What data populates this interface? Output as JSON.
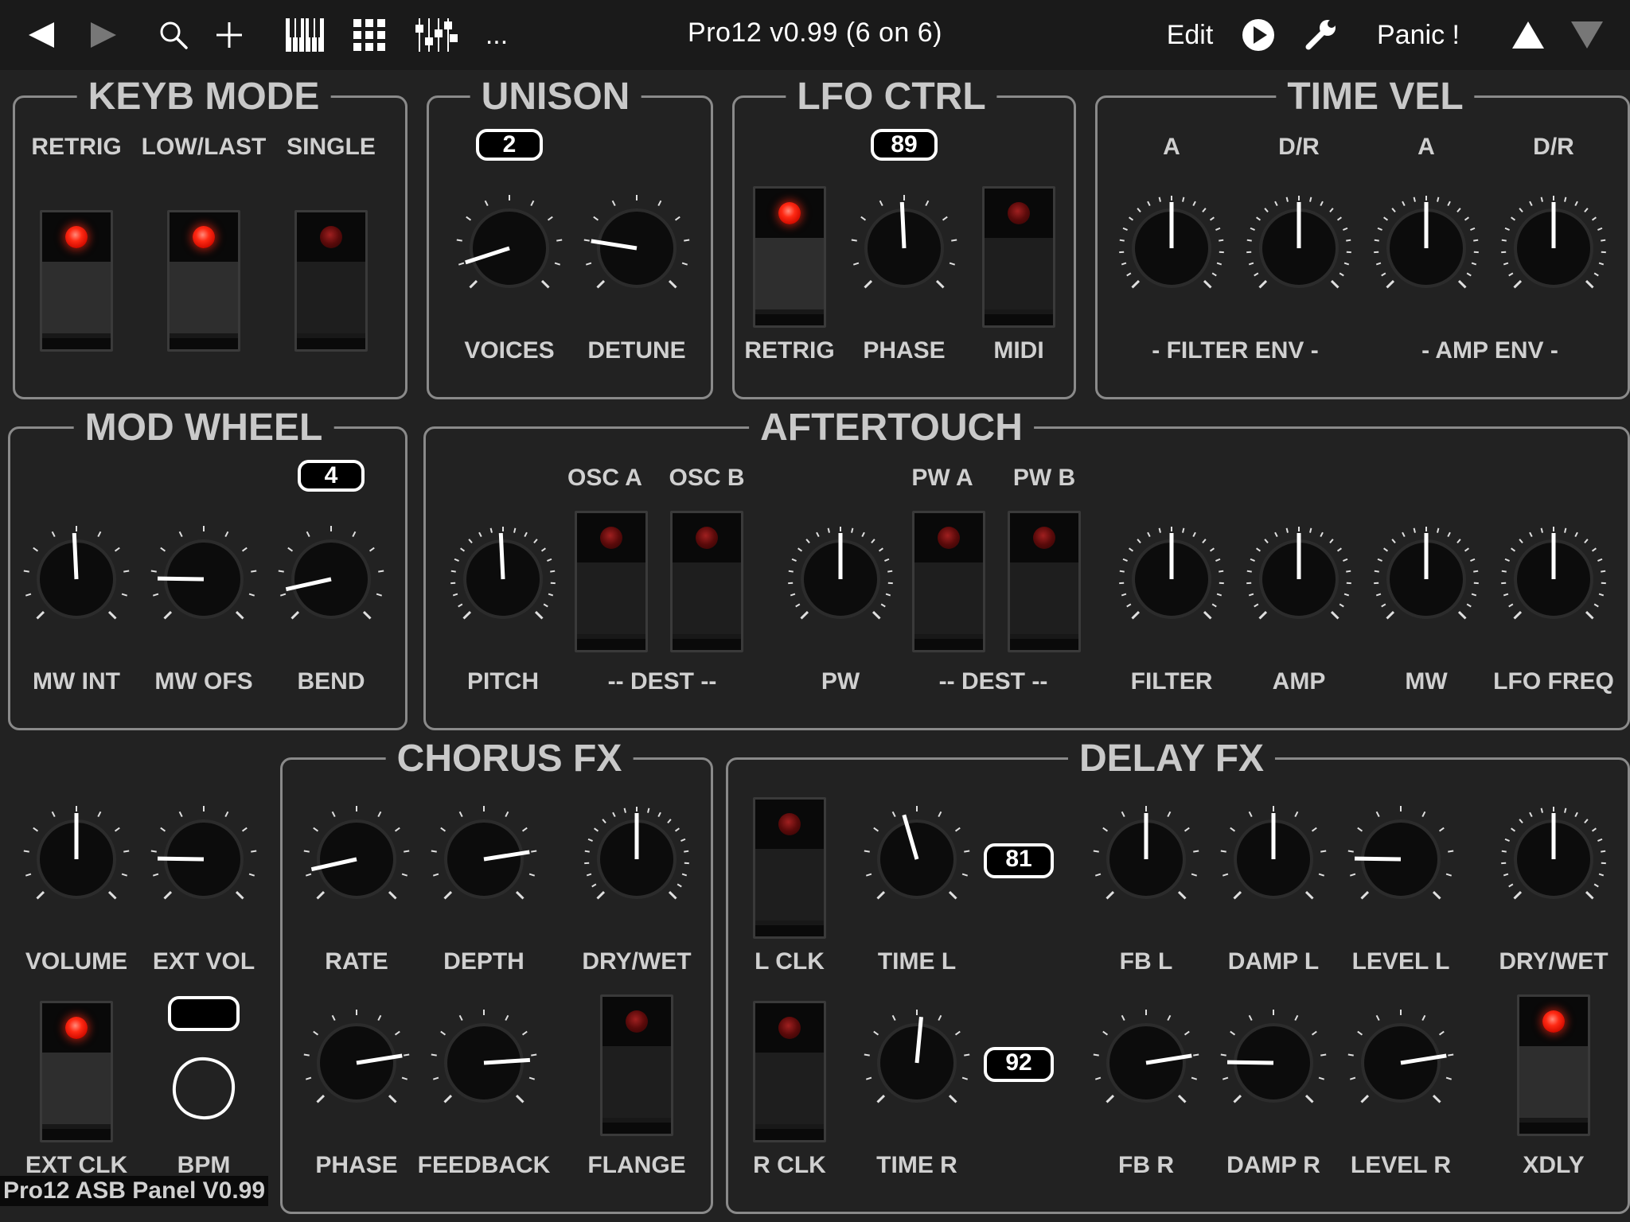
{
  "toolbar": {
    "title": "Pro12 v0.99  (6 on 6)",
    "edit_label": "Edit",
    "panic_label": "Panic !",
    "more_label": "...",
    "icons": [
      "back-icon",
      "forward-icon",
      "search-icon",
      "plus-icon",
      "keyboard-icon",
      "grid-icon",
      "mixer-icon",
      "more-icon",
      "play-icon",
      "wrench-icon",
      "arrow-up-icon",
      "arrow-down-icon"
    ]
  },
  "panels": {
    "keyb_mode": {
      "title": "KEYB MODE",
      "labels": [
        "RETRIG",
        "LOW/LAST",
        "SINGLE"
      ],
      "leds": [
        true,
        true,
        false
      ]
    },
    "unison": {
      "title": "UNISON",
      "value": "2",
      "labels": [
        "VOICES",
        "DETUNE"
      ]
    },
    "lfo_ctrl": {
      "title": "LFO CTRL",
      "value": "89",
      "labels": [
        "RETRIG",
        "PHASE",
        "MIDI"
      ],
      "leds": [
        true,
        false
      ]
    },
    "time_vel": {
      "title": "TIME VEL",
      "labels": [
        "A",
        "D/R",
        "A",
        "D/R"
      ],
      "groups": [
        "- FILTER ENV -",
        "- AMP ENV -"
      ]
    },
    "mod_wheel": {
      "title": "MOD WHEEL",
      "value": "4",
      "labels": [
        "MW INT",
        "MW OFS",
        "BEND"
      ]
    },
    "aftertouch": {
      "title": "AFTERTOUCH",
      "dest_labels": [
        "OSC A",
        "OSC B",
        "PW A",
        "PW B"
      ],
      "labels": [
        "PITCH",
        "-- DEST --",
        "PW",
        "-- DEST --",
        "FILTER",
        "AMP",
        "MW",
        "LFO FREQ"
      ],
      "leds": [
        false,
        false,
        false,
        false
      ]
    },
    "master": {
      "labels": [
        "VOLUME",
        "EXT VOL",
        "EXT CLK",
        "BPM"
      ],
      "bpm_value": "",
      "leds": [
        true
      ]
    },
    "chorus_fx": {
      "title": "CHORUS FX",
      "labels": [
        "RATE",
        "DEPTH",
        "DRY/WET",
        "PHASE",
        "FEEDBACK",
        "FLANGE"
      ],
      "leds": [
        false
      ]
    },
    "delay_fx": {
      "title": "DELAY FX",
      "time_l_value": "81",
      "time_r_value": "92",
      "labels": [
        "L CLK",
        "TIME L",
        "FB L",
        "DAMP L",
        "LEVEL L",
        "DRY/WET",
        "R CLK",
        "TIME R",
        "FB R",
        "DAMP R",
        "LEVEL R",
        "XDLY"
      ],
      "leds": [
        false,
        false,
        true
      ]
    }
  },
  "knobs": {
    "unison_voices": 0.1,
    "unison_detune": 0.2,
    "lfo_phase": 0.49,
    "tv_filter_a": 0.5,
    "tv_filter_dr": 0.5,
    "tv_amp_a": 0.5,
    "tv_amp_dr": 0.5,
    "mw_int": 0.49,
    "mw_ofs": 0.17,
    "mw_bend": 0.12,
    "at_pitch": 0.49,
    "at_pw": 0.5,
    "at_filter": 0.5,
    "at_amp": 0.5,
    "at_mw": 0.5,
    "at_lfo_freq": 0.5,
    "volume": 0.5,
    "ext_vol": 0.17,
    "ch_rate": 0.12,
    "ch_depth": 0.8,
    "ch_drywet": 0.5,
    "ch_phase": 0.8,
    "ch_feedback": 0.82,
    "dl_time_l": 0.44,
    "dl_fb_l": 0.5,
    "dl_damp_l": 0.5,
    "dl_level_l": 0.17,
    "dl_drywet": 0.5,
    "dl_time_r": 0.52,
    "dl_fb_r": 0.8,
    "dl_damp_r": 0.17,
    "dl_level_r": 0.8
  },
  "footer": {
    "text": "Pro12 ASB Panel V0.99"
  }
}
